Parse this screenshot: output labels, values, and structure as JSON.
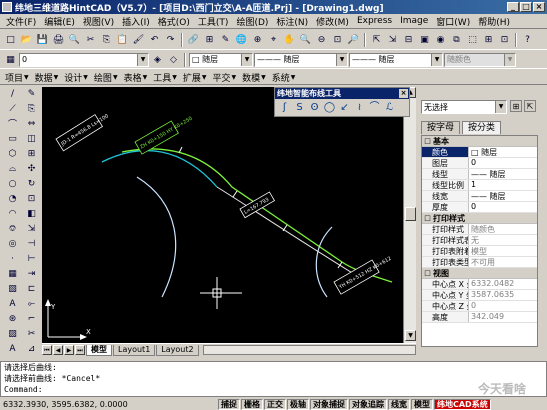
{
  "window": {
    "title": "纬地三维道路HintCAD（V5.7）- [项目D:\\西门立交\\A-A匝道.Prj] - [Drawing1.dwg]",
    "buttons": [
      "_",
      "□",
      "×"
    ]
  },
  "menu": [
    "文件(F)",
    "编辑(E)",
    "视图(V)",
    "插入(I)",
    "格式(O)",
    "工具(T)",
    "绘图(D)",
    "标注(N)",
    "修改(M)",
    "Express",
    "Image",
    "窗口(W)",
    "帮助(H)"
  ],
  "toolbar1": {
    "groupA": [
      "□",
      "📂",
      "💾",
      "🖨",
      "🔍",
      "✂",
      "⎘",
      "📋",
      "🖌",
      "↶",
      "↷"
    ],
    "groupB": [
      "🔗",
      "⊞",
      "✎",
      "🌐",
      "⊕",
      "⌖",
      "✋",
      "🔍",
      "⊖",
      "⊡",
      "🔎"
    ],
    "groupC": [
      "⇱",
      "⇲",
      "⊟",
      "▣",
      "◉",
      "⧉",
      "⬚",
      "⊞",
      "⊡"
    ],
    "help": "?"
  },
  "toolbar2": {
    "layer_value": "0",
    "color_value": "□ 随层",
    "linetype_value": "——— 随层",
    "lineweight_value": "——— 随层",
    "plotstyle_value": "随颜色"
  },
  "tabs": [
    "项目",
    "数据",
    "设计",
    "绘图",
    "表格",
    "工具",
    "扩展",
    "平交",
    "数模",
    "系统"
  ],
  "left_toolbar_a": [
    "/",
    "⟋",
    "⌒",
    "▭",
    "⬡",
    "⌓",
    "○",
    "◔",
    "◠",
    "⎊",
    "◎",
    "·",
    "▦",
    "▧",
    "A",
    "⊛",
    "▨",
    "A"
  ],
  "left_toolbar_b": [
    "✎",
    "⎘",
    "⇔",
    "◫",
    "⊞",
    "✣",
    "↻",
    "⊡",
    "◧",
    "⇲",
    "⊣",
    "⊢",
    "⇥",
    "⊏",
    "⟜",
    "⌐",
    "✂",
    "⊿"
  ],
  "palette": {
    "title": "纬地智能布线工具",
    "close": "×",
    "icons": [
      "ʃ",
      "S",
      "ʘ",
      "◯",
      "↙",
      "≀",
      "⌒",
      "ℒ"
    ]
  },
  "drawing": {
    "tags": [
      "JD-1 R=456.8 Ls=100",
      "ZH K0+150 HY K0+250",
      "L=167.793",
      "YH K0+512 HZ K0+612"
    ],
    "axis": {
      "x": "X",
      "y": "Y"
    }
  },
  "layout_tabs": [
    "模型",
    "Layout1",
    "Layout2"
  ],
  "properties": {
    "select_value": "无选择",
    "tabs": [
      "按字母",
      "按分类"
    ],
    "sections": [
      {
        "name": "基本",
        "rows": [
          {
            "k": "颜色",
            "v": "□ 随层"
          },
          {
            "k": "图层",
            "v": "0"
          },
          {
            "k": "线型",
            "v": "—— 随层"
          },
          {
            "k": "线型比例",
            "v": "1"
          },
          {
            "k": "线宽",
            "v": "—— 随层"
          },
          {
            "k": "厚度",
            "v": "0"
          }
        ]
      },
      {
        "name": "打印样式",
        "rows": [
          {
            "k": "打印样式",
            "v": "随颜色"
          },
          {
            "k": "打印样式表",
            "v": "无"
          },
          {
            "k": "打印表附着到",
            "v": "模型"
          },
          {
            "k": "打印表类型",
            "v": "不可用"
          }
        ]
      },
      {
        "name": "视图",
        "rows": [
          {
            "k": "中心点 X 坐",
            "v": "6332.0482"
          },
          {
            "k": "中心点 Y 坐",
            "v": "3587.0635"
          },
          {
            "k": "中心点 Z 坐",
            "v": "0"
          },
          {
            "k": "高度",
            "v": "342.049"
          }
        ]
      }
    ]
  },
  "command_lines": [
    "请选择后曲线:",
    "请选择前曲线: *Cancel*",
    "Command:"
  ],
  "status": {
    "coords": "6332.3930, 3595.6382, 0.0000",
    "buttons": [
      "捕捉",
      "栅格",
      "正交",
      "极轴",
      "对象捕捉",
      "对象追踪",
      "线宽",
      "模型"
    ],
    "app_button": "纬地CAD系统"
  },
  "watermark": "今天看啥"
}
